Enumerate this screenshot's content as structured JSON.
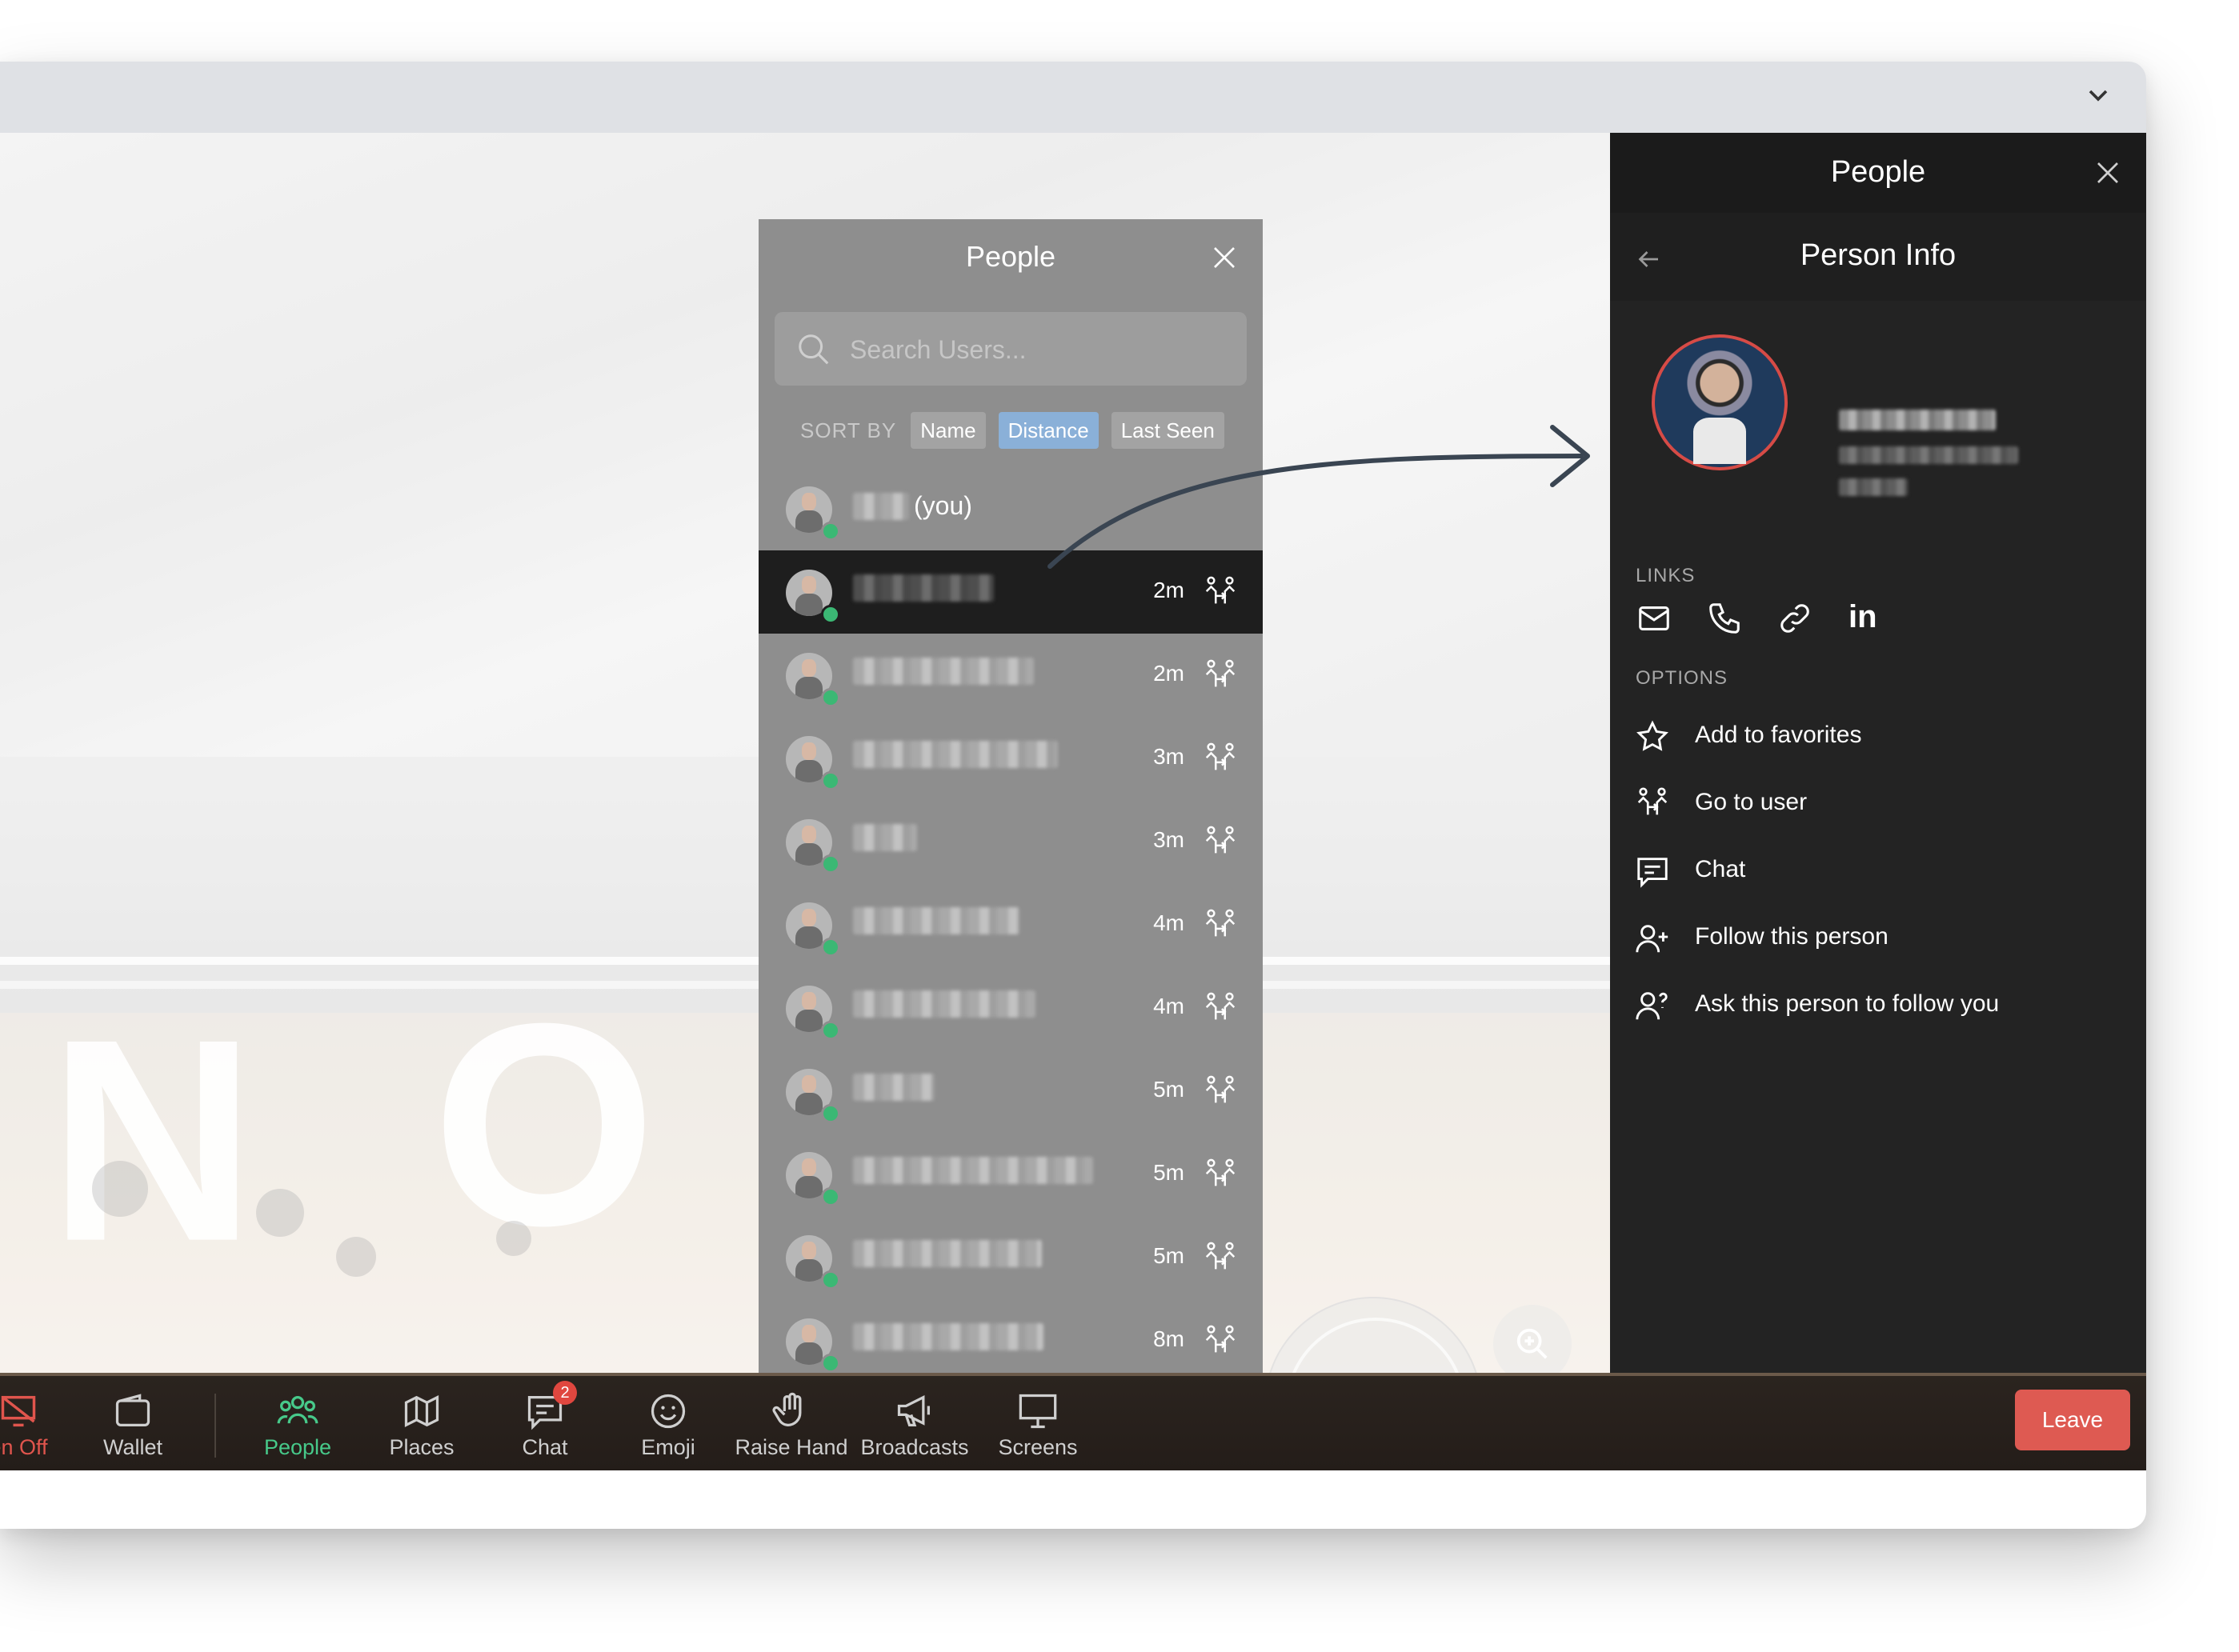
{
  "people_list": {
    "title": "People",
    "search_placeholder": "Search Users...",
    "sort_label": "SORT BY",
    "sort_options": [
      "Name",
      "Distance",
      "Last Seen"
    ],
    "active_sort": "Distance",
    "you_suffix": "(you)",
    "rows": [
      {
        "time": "",
        "selected": false,
        "is_you": true
      },
      {
        "time": "2m",
        "selected": true
      },
      {
        "time": "2m"
      },
      {
        "time": "3m"
      },
      {
        "time": "3m"
      },
      {
        "time": "4m"
      },
      {
        "time": "4m"
      },
      {
        "time": "5m"
      },
      {
        "time": "5m"
      },
      {
        "time": "5m"
      },
      {
        "time": "8m"
      }
    ]
  },
  "panel": {
    "title": "People",
    "subtitle": "Person Info",
    "links_label": "LINKS",
    "links": [
      "mail-icon",
      "phone-icon",
      "link-icon",
      "linkedin-icon"
    ],
    "linkedin_text": "in",
    "options_label": "OPTIONS",
    "options": [
      {
        "label": "Add to favorites",
        "icon": "star-icon"
      },
      {
        "label": "Go to user",
        "icon": "goto-user-icon"
      },
      {
        "label": "Chat",
        "icon": "chat-icon"
      },
      {
        "label": "Follow this person",
        "icon": "follow-icon"
      },
      {
        "label": "Ask this person to follow you",
        "icon": "ask-follow-icon"
      }
    ]
  },
  "bottom_bar": {
    "items": [
      {
        "label": "en Off",
        "icon": "screen-off-icon"
      },
      {
        "label": "Wallet",
        "icon": "wallet-icon"
      },
      {
        "label": "People",
        "icon": "people-icon",
        "active": true
      },
      {
        "label": "Places",
        "icon": "map-icon"
      },
      {
        "label": "Chat",
        "icon": "chat-icon",
        "badge": "2"
      },
      {
        "label": "Emoji",
        "icon": "emoji-icon"
      },
      {
        "label": "Raise Hand",
        "icon": "hand-icon"
      },
      {
        "label": "Broadcasts",
        "icon": "megaphone-icon"
      },
      {
        "label": "Screens",
        "icon": "monitor-icon"
      }
    ],
    "leave_label": "Leave"
  },
  "colors": {
    "accent_green": "#47c98a",
    "leave_red": "#de5a52",
    "active_sort": "#8ab0d8",
    "online": "#3bb874"
  }
}
